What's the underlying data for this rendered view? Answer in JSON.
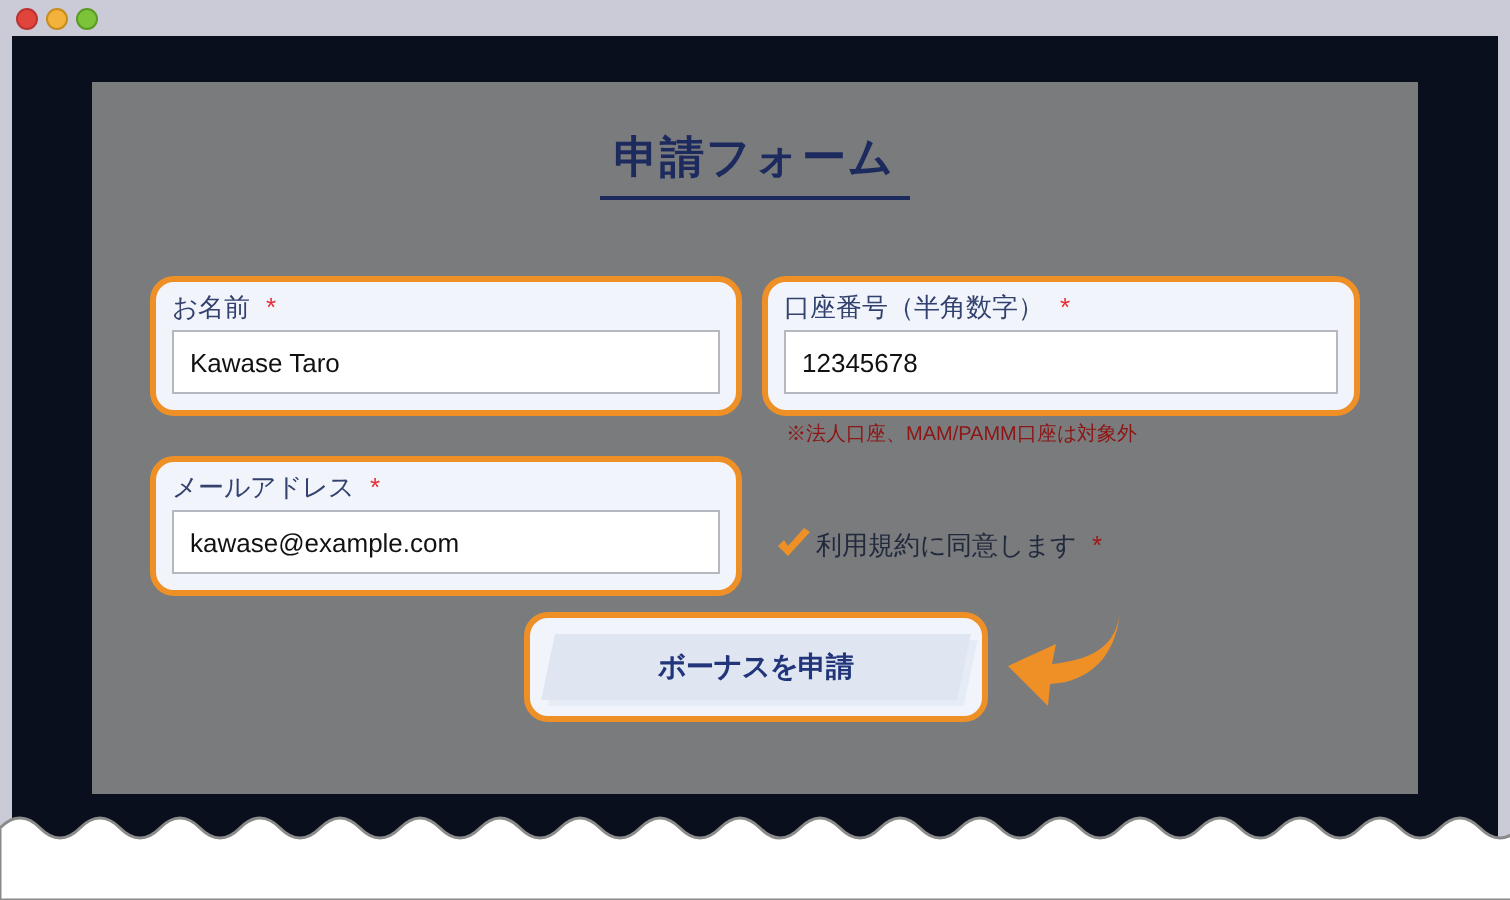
{
  "form": {
    "title": "申請フォーム",
    "fields": [
      {
        "label": "お名前",
        "required_mark": "*",
        "value": "Kawase Taro"
      },
      {
        "label": "口座番号（半角数字）",
        "required_mark": "*",
        "value": "12345678",
        "note": "※法人口座、MAM/PAMM口座は対象外"
      },
      {
        "label": "メールアドレス",
        "required_mark": "*",
        "value": "kawase@example.com"
      }
    ],
    "agree": {
      "label": "利用規約に同意します",
      "required_mark": "*",
      "checked": true
    },
    "submit": {
      "label": "ボーナスを申請"
    }
  }
}
